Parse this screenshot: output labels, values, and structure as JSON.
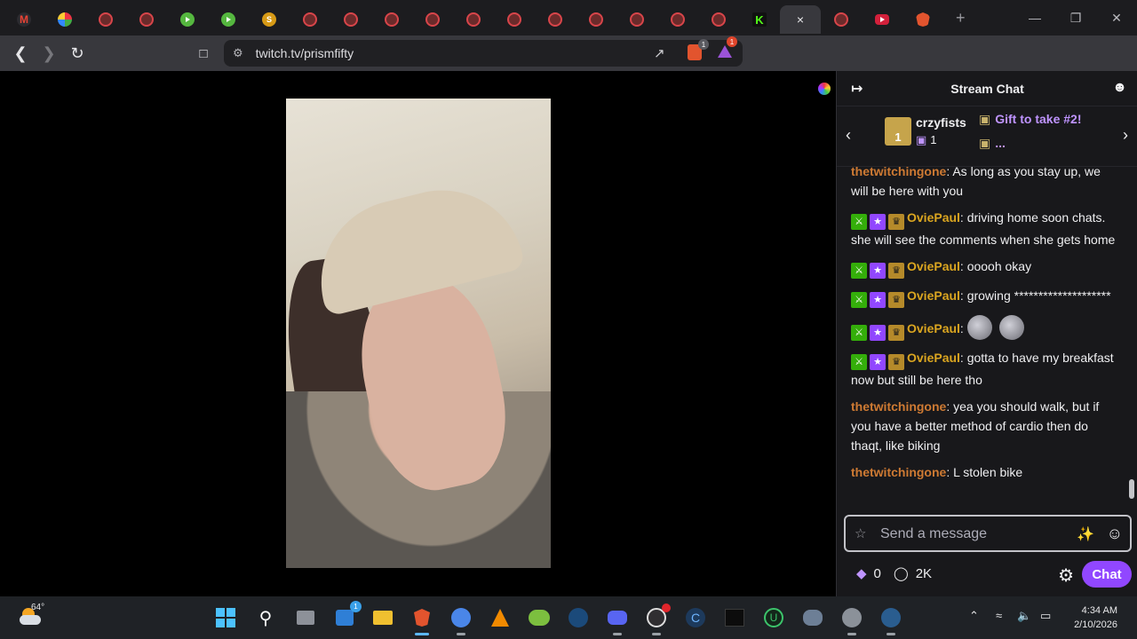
{
  "browser": {
    "url": "twitch.tv/prismfifty",
    "tab_close_glyph": "×",
    "new_tab_glyph": "+",
    "ext_badge_1": "1",
    "ext_badge_2": "1"
  },
  "chat": {
    "title": "Stream Chat",
    "gift": {
      "user": "crzyfists",
      "count": "1",
      "box_number": "1",
      "line1": "Gift to take #2!",
      "line2": "..."
    },
    "messages": [
      {
        "user": "thetwitchingone",
        "text": ": As long as you stay up, we will be here with you",
        "badges": false,
        "emotes": 0
      },
      {
        "user": "OviePaul",
        "text": ": driving home soon chats. she will see the comments when she gets home",
        "badges": true,
        "emotes": 0
      },
      {
        "user": "OviePaul",
        "text": ": ooooh okay",
        "badges": true,
        "emotes": 0
      },
      {
        "user": "OviePaul",
        "text": ": growing ********************",
        "badges": true,
        "emotes": 0
      },
      {
        "user": "OviePaul",
        "text": ":",
        "badges": true,
        "emotes": 2
      },
      {
        "user": "OviePaul",
        "text": ": gotta to have my breakfast now but still be here tho",
        "badges": true,
        "emotes": 0
      },
      {
        "user": "thetwitchingone",
        "text": ": yea you should walk, but if you have a better method of cardio then do thaqt, like biking",
        "badges": false,
        "emotes": 0
      },
      {
        "user": "thetwitchingone",
        "text": ": L stolen bike",
        "badges": false,
        "emotes": 0
      }
    ],
    "input_placeholder": "Send a message",
    "points_bits": "0",
    "points_channel": "2K",
    "send_label": "Chat"
  },
  "taskbar": {
    "temperature": "64°",
    "store_badge": "1",
    "time": "4:34 AM",
    "date": "2/10/2026"
  },
  "colors": {
    "twitch_purple": "#9147ff",
    "chat_bg": "#18181b",
    "username_orange": "#ce7a33",
    "username_gold": "#daa520"
  }
}
